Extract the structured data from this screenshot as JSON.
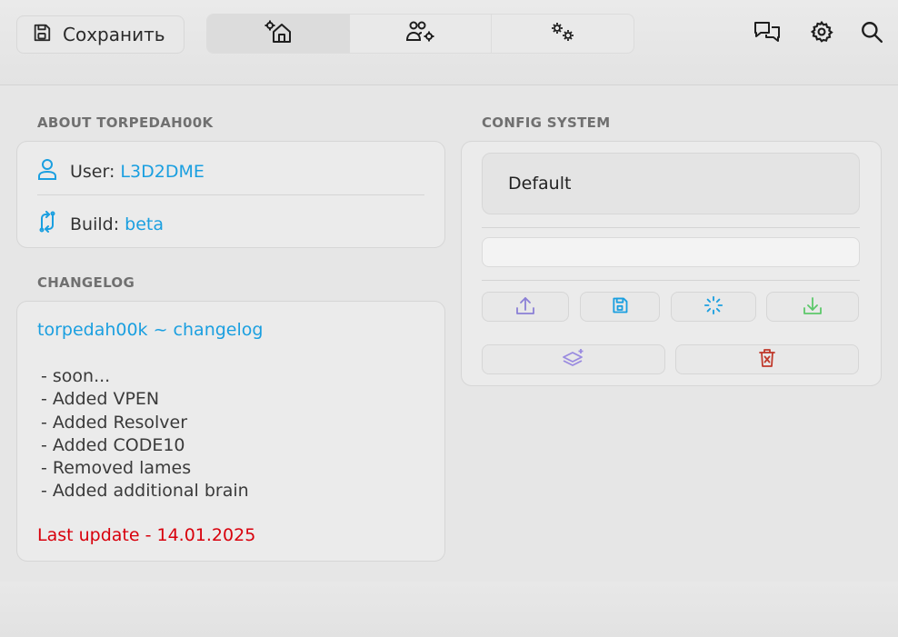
{
  "toolbar": {
    "save_label": "Сохранить",
    "tabs": [
      {
        "icon": "home-settings-icon",
        "active": true
      },
      {
        "icon": "users-settings-icon",
        "active": false
      },
      {
        "icon": "gears-icon",
        "active": false
      }
    ],
    "right_icons": [
      "chat-icon",
      "gear-icon",
      "search-icon"
    ]
  },
  "about": {
    "section_title": "ABOUT TORPEDAH00K",
    "user_label": "User:",
    "user_value": "L3D2DME",
    "build_label": "Build:",
    "build_value": "beta"
  },
  "changelog": {
    "section_title": "CHANGELOG",
    "title": "torpedah00k ~ changelog",
    "lines": [
      "- soon...",
      "- Added VPEN",
      "- Added Resolver",
      "- Added CODE10",
      "- Removed lames",
      "- Added additional brain"
    ],
    "last_update": "Last update - 14.01.2025"
  },
  "config": {
    "section_title": "CONFIG SYSTEM",
    "selected_config": "Default",
    "name_input_value": "",
    "name_input_placeholder": "",
    "buttons": [
      "upload-icon",
      "save-icon",
      "loading-icon",
      "download-icon",
      "layers-icon",
      "delete-icon"
    ]
  },
  "colors": {
    "accent": "#1a9fe0",
    "warning": "#d8000c",
    "upload": "#8a7fd6",
    "save": "#1a9fe0",
    "load": "#1a9fe0",
    "download": "#5cc86a",
    "layers": "#9a8be0",
    "delete": "#c0392b"
  }
}
